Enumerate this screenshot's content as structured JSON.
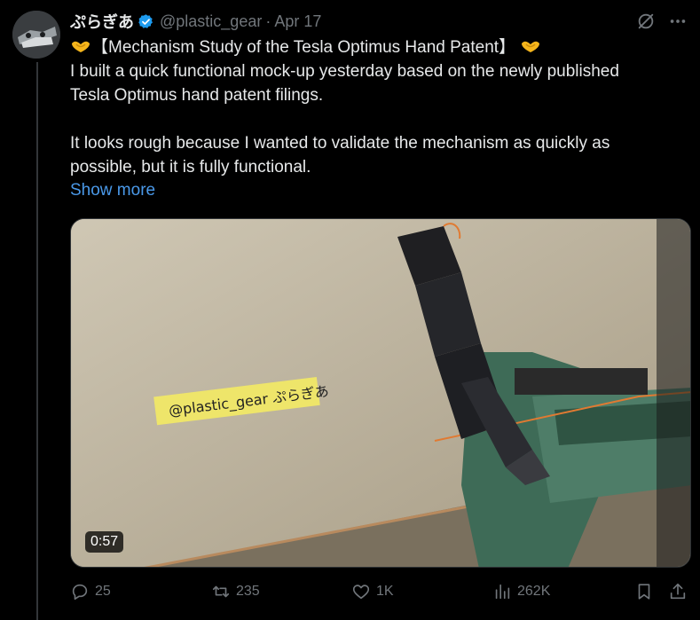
{
  "tweet": {
    "display_name": "ぷらぎあ",
    "handle": "@plastic_gear",
    "separator": "·",
    "time": "Apr 17",
    "title_line": "【Mechanism Study of the Tesla Optimus Hand Patent】",
    "paragraph1_line1": "I built a quick functional mock-up yesterday based on the newly published",
    "paragraph1_line2": "Tesla Optimus hand patent filings.",
    "paragraph2_line1": "It looks rough because I wanted to validate the mechanism as quickly as",
    "paragraph2_line2": "possible, but it is fully functional.",
    "show_more": "Show more"
  },
  "media": {
    "type": "video",
    "duration": "0:57",
    "label_text": "@plastic_gear ぷらぎあ"
  },
  "actions": {
    "replies": "25",
    "reposts": "235",
    "likes": "1K",
    "views": "262K"
  },
  "colors": {
    "background": "#000000",
    "text": "#e7e9ea",
    "muted": "#71767b",
    "link": "#4a99e9",
    "verified": "#1d9bf0"
  },
  "icons": [
    "verified-badge-icon",
    "grok-icon",
    "more-icon",
    "reply-icon",
    "repost-icon",
    "like-icon",
    "views-icon",
    "bookmark-icon",
    "share-icon",
    "heart-hands-emoji"
  ]
}
